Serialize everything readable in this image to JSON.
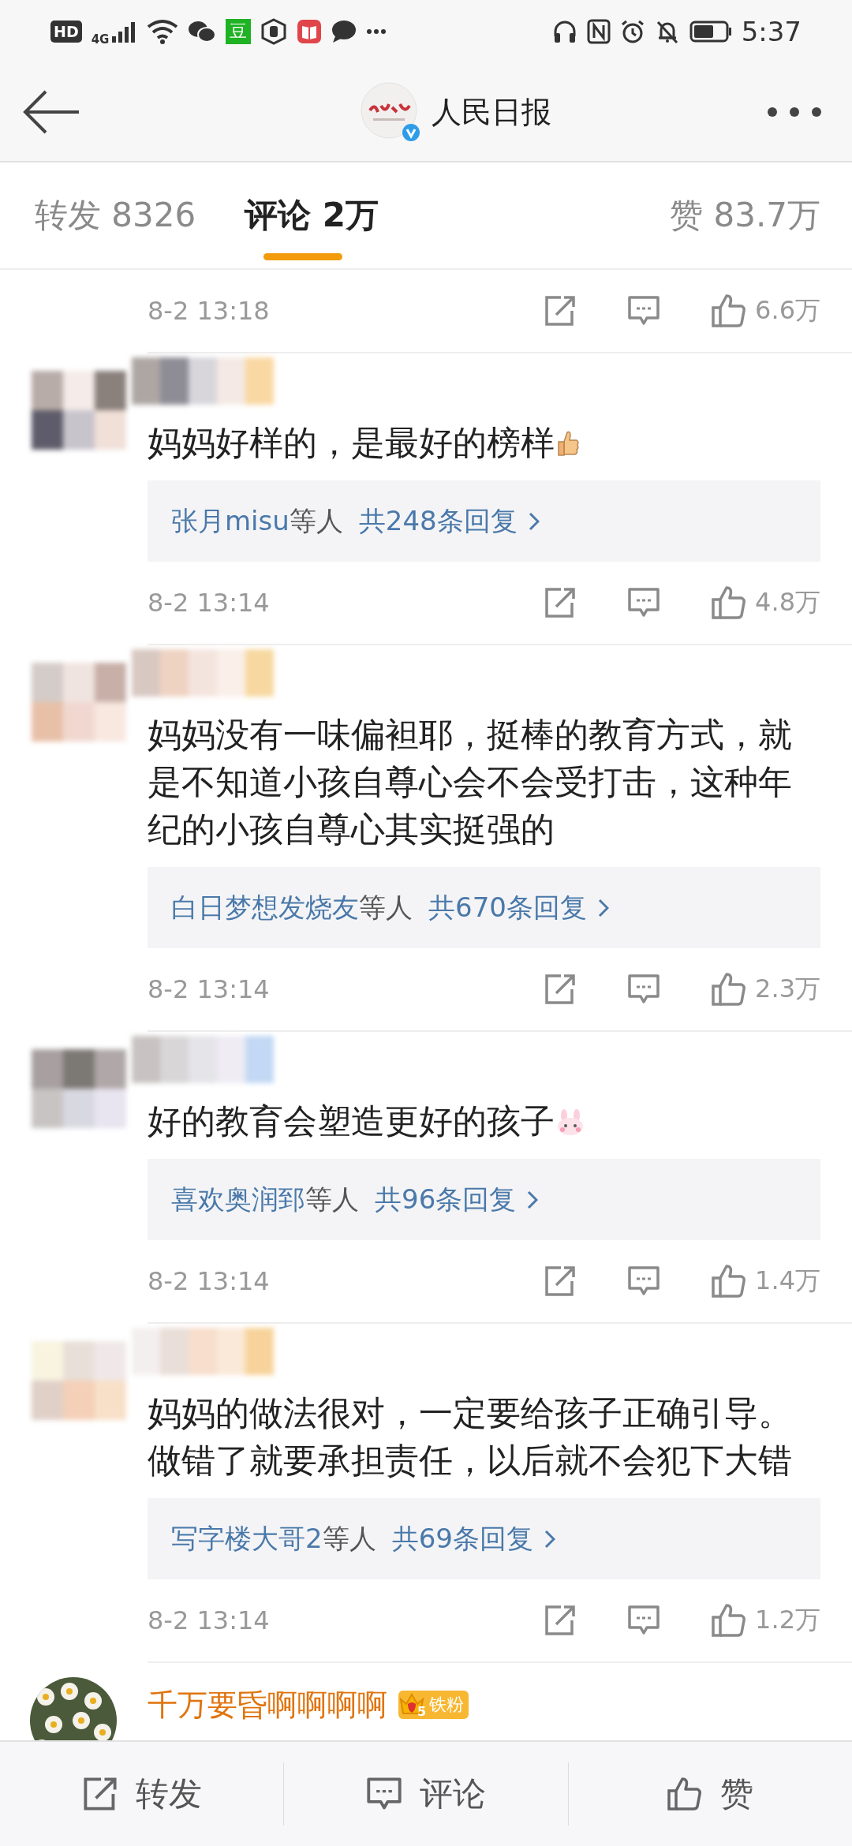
{
  "status_bar": {
    "hd_label": "HD",
    "network": "4G",
    "app_badge": "豆",
    "time": "5:37"
  },
  "header": {
    "title": "人民日报",
    "verified": true
  },
  "tabs": [
    {
      "label": "转发 8326",
      "selected": false
    },
    {
      "label": "评论 2万",
      "selected": true
    },
    {
      "label": "赞 83.7万",
      "selected": false
    }
  ],
  "comments": [
    {
      "kind": "footer_only",
      "time": "8-2 13:18",
      "likes": "6.6万"
    },
    {
      "kind": "comment",
      "text": "妈妈好样的，是最好的榜样",
      "emoji": {
        "kind": "thumbs-up"
      },
      "reply": {
        "names": "张月misu",
        "suffix": "等人",
        "count": "共248条回复"
      },
      "time": "8-2 13:14",
      "likes": "4.8万"
    },
    {
      "kind": "comment",
      "text": "妈妈没有一味偏袒耶，挺棒的教育方式，就是不知道小孩自尊心会不会受打击，这种年纪的小孩自尊心其实挺强的",
      "reply": {
        "names": "白日梦想发烧友",
        "suffix": "等人",
        "count": "共670条回复"
      },
      "time": "8-2 13:14",
      "likes": "2.3万"
    },
    {
      "kind": "comment",
      "text": "好的教育会塑造更好的孩子",
      "emoji": {
        "kind": "bunny"
      },
      "reply": {
        "names": "喜欢奥润郅",
        "suffix": "等人",
        "count": "共96条回复"
      },
      "time": "8-2 13:14",
      "likes": "1.4万"
    },
    {
      "kind": "comment",
      "text": "妈妈的做法很对，一定要给孩子正确引导。做错了就要承担责任，以后就不会犯下大错",
      "reply": {
        "names": "写字楼大哥2",
        "suffix": "等人",
        "count": "共69条回复"
      },
      "time": "8-2 13:14",
      "likes": "1.2万"
    },
    {
      "kind": "partial",
      "name": "千万要昏啊啊啊啊",
      "badge_level": "5",
      "badge": "铁粉"
    }
  ],
  "bottom_bar": [
    {
      "kind": "repost",
      "label": "转发"
    },
    {
      "kind": "comment",
      "label": "评论"
    },
    {
      "kind": "like",
      "label": "赞"
    }
  ]
}
